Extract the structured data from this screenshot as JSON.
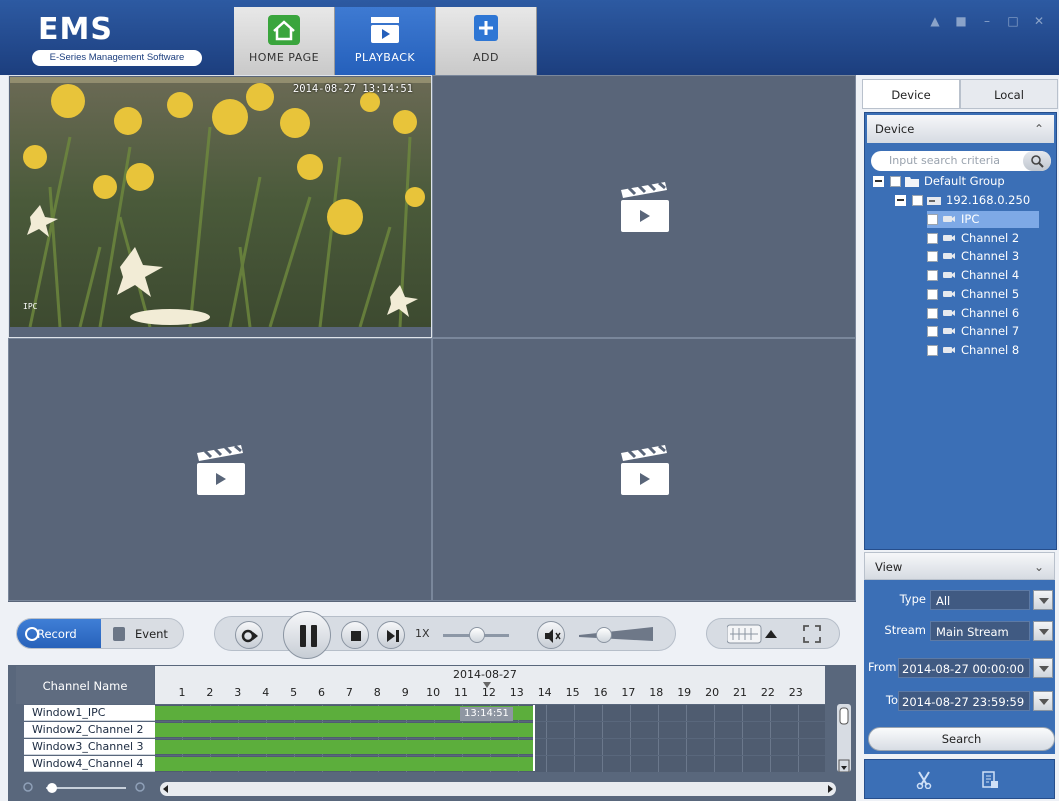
{
  "app": {
    "logo_title": "EMS",
    "logo_subtitle": "E-Series Management Software"
  },
  "nav": {
    "tabs": [
      {
        "label": "HOME PAGE",
        "icon": "home-icon",
        "active": false
      },
      {
        "label": "PLAYBACK",
        "icon": "playback-icon",
        "active": true
      },
      {
        "label": "ADD",
        "icon": "add-icon",
        "active": false
      }
    ]
  },
  "window_controls": [
    "user-icon",
    "lock-icon",
    "minimize-icon",
    "maximize-icon",
    "close-icon"
  ],
  "video": {
    "osd_time": "2014-08-27 13:14:51",
    "osd_channel": "IPC"
  },
  "controls": {
    "record_label": "Record",
    "event_label": "Event",
    "speed_label": "1X",
    "speed_level": 0.45,
    "volume_level": 0.25
  },
  "timeline": {
    "header_label": "Channel Name",
    "date": "2014-08-27",
    "hours": [
      "1",
      "2",
      "3",
      "4",
      "5",
      "6",
      "7",
      "8",
      "9",
      "10",
      "11",
      "12",
      "13",
      "14",
      "15",
      "16",
      "17",
      "18",
      "19",
      "20",
      "21",
      "22",
      "23"
    ],
    "cursor_time": "13:14:51",
    "rows": [
      {
        "name": "Window1_IPC"
      },
      {
        "name": "Window2_Channel 2"
      },
      {
        "name": "Window3_Channel 3"
      },
      {
        "name": "Window4_Channel 4"
      }
    ]
  },
  "right_panel": {
    "tabs": [
      "Device",
      "Local"
    ],
    "device_header": "Device",
    "search_placeholder": "Input search criteria",
    "tree": {
      "group": "Default Group",
      "device": "192.168.0.250",
      "channels": [
        "IPC",
        "Channel 2",
        "Channel 3",
        "Channel 4",
        "Channel 5",
        "Channel 6",
        "Channel 7",
        "Channel 8"
      ]
    },
    "view_header": "View",
    "type_label": "Type",
    "type_value": "All",
    "stream_label": "Stream",
    "stream_value": "Main Stream",
    "from_label": "From",
    "from_value": "2014-08-27 00:00:00",
    "to_label": "To",
    "to_value": "2014-08-27 23:59:59",
    "search_button": "Search"
  }
}
